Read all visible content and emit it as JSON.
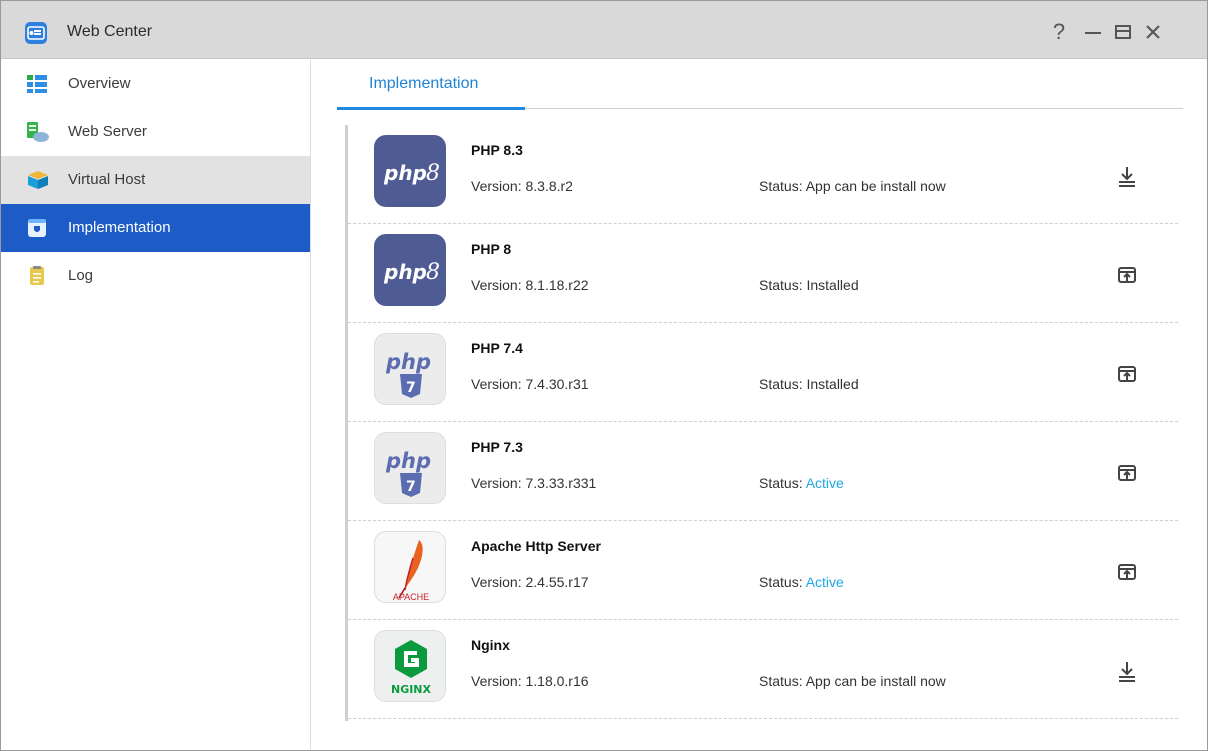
{
  "app": {
    "title": "Web Center",
    "icon": "web-center-icon",
    "controls": {
      "help": "?",
      "minimize": "minimize-icon",
      "maximize": "maximize-icon",
      "close": "close-icon"
    }
  },
  "sidebar": {
    "items": [
      {
        "label": "Overview",
        "icon": "overview-icon",
        "state": "normal"
      },
      {
        "label": "Web Server",
        "icon": "web-server-icon",
        "state": "normal"
      },
      {
        "label": "Virtual Host",
        "icon": "virtual-host-icon",
        "state": "hover"
      },
      {
        "label": "Implementation",
        "icon": "implementation-icon",
        "state": "active"
      },
      {
        "label": "Log",
        "icon": "log-icon",
        "state": "normal"
      }
    ]
  },
  "main": {
    "tabs": [
      {
        "label": "Implementation",
        "selected": true
      }
    ],
    "version_prefix": "Version: ",
    "status_prefix": "Status: ",
    "apps": [
      {
        "name": "PHP 8.3",
        "version": "8.3.8.r2",
        "status": "App can be install now",
        "status_active": false,
        "logo": "php8",
        "action": "download-icon"
      },
      {
        "name": "PHP 8",
        "version": "8.1.18.r22",
        "status": "Installed",
        "status_active": false,
        "logo": "php8",
        "action": "open-icon"
      },
      {
        "name": "PHP 7.4",
        "version": "7.4.30.r31",
        "status": "Installed",
        "status_active": false,
        "logo": "php7",
        "action": "open-icon"
      },
      {
        "name": "PHP 7.3",
        "version": "7.3.33.r331",
        "status": "Active",
        "status_active": true,
        "logo": "php7",
        "action": "open-icon"
      },
      {
        "name": "Apache Http Server",
        "version": "2.4.55.r17",
        "status": "Active",
        "status_active": true,
        "logo": "apache",
        "action": "open-icon",
        "logo_text": "APACHE"
      },
      {
        "name": "Nginx",
        "version": "1.18.0.r16",
        "status": "App can be install now",
        "status_active": false,
        "logo": "nginx",
        "action": "download-icon",
        "logo_text": "NGINX"
      }
    ]
  },
  "colors": {
    "active_nav": "#1d5bc6",
    "tab_accent": "#1f8ae0",
    "status_active": "#1ea7e4",
    "php_logo_bg": "#4f5b93"
  }
}
